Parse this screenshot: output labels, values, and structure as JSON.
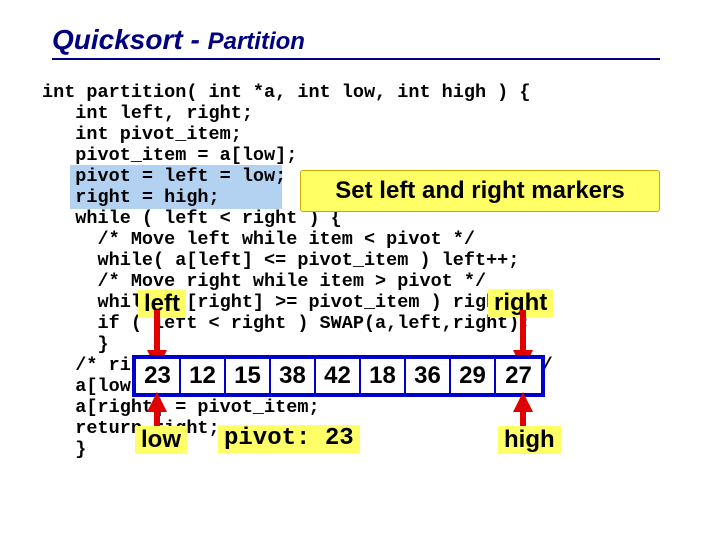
{
  "title": {
    "main": "Quicksort - ",
    "sub": "Partition"
  },
  "code": "int partition( int *a, int low, int high ) {\n   int left, right;\n   int pivot_item;\n   pivot_item = a[low];\n   pivot = left = low;\n   right = high;\n   while ( left < right ) {\n     /* Move left while item < pivot */\n     while( a[left] <= pivot_item ) left++;\n     /* Move right while item > pivot */\n     while( a[right] >= pivot_item ) right--;\n     if ( left < right ) SWAP(a,left,right);\n     }\n   /* right is final position for the pivot */\n   a[low] = a[right];\n   a[right] = pivot_item;\n   return right;\n   }",
  "callout": "Set left and right markers",
  "labels": {
    "left": "left",
    "right": "right",
    "low": "low",
    "high": "high",
    "pivot": "pivot: 23"
  },
  "array": [
    "23",
    "12",
    "15",
    "38",
    "42",
    "18",
    "36",
    "29",
    "27"
  ]
}
